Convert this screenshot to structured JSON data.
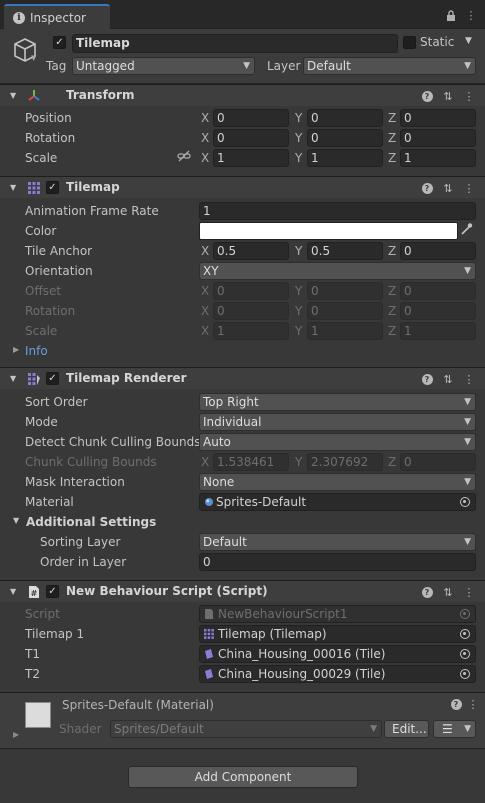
{
  "tab": {
    "title": "Inspector"
  },
  "object": {
    "name": "Tilemap",
    "static_label": "Static",
    "tag_label": "Tag",
    "tag_value": "Untagged",
    "layer_label": "Layer",
    "layer_value": "Default"
  },
  "transform": {
    "title": "Transform",
    "rows": [
      {
        "label": "Position",
        "x": "0",
        "y": "0",
        "z": "0"
      },
      {
        "label": "Rotation",
        "x": "0",
        "y": "0",
        "z": "0"
      },
      {
        "label": "Scale",
        "x": "1",
        "y": "1",
        "z": "1"
      }
    ]
  },
  "tilemap": {
    "title": "Tilemap",
    "animation_frame_rate_label": "Animation Frame Rate",
    "animation_frame_rate": "1",
    "color_label": "Color",
    "color_value": "#ffffff",
    "tile_anchor_label": "Tile Anchor",
    "tile_anchor": {
      "x": "0.5",
      "y": "0.5",
      "z": "0"
    },
    "orientation_label": "Orientation",
    "orientation_value": "XY",
    "disabled_rows": [
      {
        "label": "Offset",
        "x": "0",
        "y": "0",
        "z": "0"
      },
      {
        "label": "Rotation",
        "x": "0",
        "y": "0",
        "z": "0"
      },
      {
        "label": "Scale",
        "x": "1",
        "y": "1",
        "z": "1"
      }
    ],
    "info_label": "Info"
  },
  "renderer": {
    "title": "Tilemap Renderer",
    "sort_order_label": "Sort Order",
    "sort_order_value": "Top Right",
    "mode_label": "Mode",
    "mode_value": "Individual",
    "detect_label": "Detect Chunk Culling Bounds",
    "detect_value": "Auto",
    "chunk_label": "Chunk Culling Bounds",
    "chunk": {
      "x": "1.538461",
      "y": "2.307692",
      "z": "0"
    },
    "mask_label": "Mask Interaction",
    "mask_value": "None",
    "material_label": "Material",
    "material_value": "Sprites-Default",
    "additional_label": "Additional Settings",
    "sorting_layer_label": "Sorting Layer",
    "sorting_layer_value": "Default",
    "order_label": "Order in Layer",
    "order_value": "0"
  },
  "script": {
    "title": "New Behaviour Script (Script)",
    "script_label": "Script",
    "script_value": "NewBehaviourScript1",
    "tilemap1_label": "Tilemap 1",
    "tilemap1_value": "Tilemap (Tilemap)",
    "t1_label": "T1",
    "t1_value": "China_Housing_00016 (Tile)",
    "t2_label": "T2",
    "t2_value": "China_Housing_00029 (Tile)"
  },
  "material": {
    "title": "Sprites-Default (Material)",
    "shader_label": "Shader",
    "shader_value": "Sprites/Default",
    "edit_label": "Edit..."
  },
  "add_component_label": "Add Component",
  "axes": {
    "x": "X",
    "y": "Y",
    "z": "Z"
  }
}
